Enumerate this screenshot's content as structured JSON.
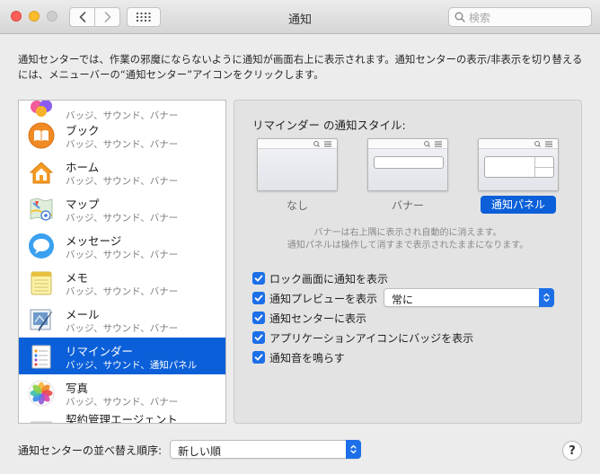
{
  "window": {
    "title": "通知",
    "search_placeholder": "検索"
  },
  "description": "通知センターでは、作業の邪魔にならないように通知が画面右上に表示されます。通知センターの表示/非表示を切り替えるには、メニューバーの“通知センター”アイコンをクリックします。",
  "apps": [
    {
      "name": "",
      "sub": "バッジ、サウンド、バナー",
      "icon": "game-center-icon"
    },
    {
      "name": "ブック",
      "sub": "バッジ、サウンド、バナー",
      "icon": "books-icon"
    },
    {
      "name": "ホーム",
      "sub": "バッジ、サウンド、バナー",
      "icon": "home-icon"
    },
    {
      "name": "マップ",
      "sub": "バッジ、サウンド、バナー",
      "icon": "maps-icon"
    },
    {
      "name": "メッセージ",
      "sub": "バッジ、サウンド、バナー",
      "icon": "messages-icon"
    },
    {
      "name": "メモ",
      "sub": "バッジ、サウンド、バナー",
      "icon": "notes-icon"
    },
    {
      "name": "メール",
      "sub": "バッジ、サウンド、バナー",
      "icon": "mail-icon"
    },
    {
      "name": "リマインダー",
      "sub": "バッジ、サウンド、通知パネル",
      "icon": "reminders-icon",
      "selected": true
    },
    {
      "name": "写真",
      "sub": "バッジ、サウンド、バナー",
      "icon": "photos-icon"
    },
    {
      "name": "契約管理エージェント",
      "sub": "",
      "icon": "contract-agent-icon"
    }
  ],
  "settings": {
    "heading": "リマインダー の通知スタイル:",
    "styles": [
      {
        "label": "なし"
      },
      {
        "label": "バナー"
      },
      {
        "label": "通知パネル",
        "selected": true
      }
    ],
    "hint_line1": "バナーは右上隅に表示され自動的に消えます。",
    "hint_line2": "通知パネルは操作して消すまで表示されたままになります。",
    "options": [
      {
        "label": "ロック画面に通知を表示",
        "checked": true
      },
      {
        "label": "通知プレビューを表示",
        "checked": true
      },
      {
        "label": "通知センターに表示",
        "checked": true
      },
      {
        "label": "アプリケーションアイコンにバッジを表示",
        "checked": true
      },
      {
        "label": "通知音を鳴らす",
        "checked": true
      }
    ],
    "preview_popup_value": "常に"
  },
  "footer": {
    "sort_label": "通知センターの並べ替え順序:",
    "sort_value": "新しい順",
    "help_label": "?"
  },
  "colors": {
    "accent": "#0b5fd8",
    "checkbox": "#1d6fe8"
  }
}
